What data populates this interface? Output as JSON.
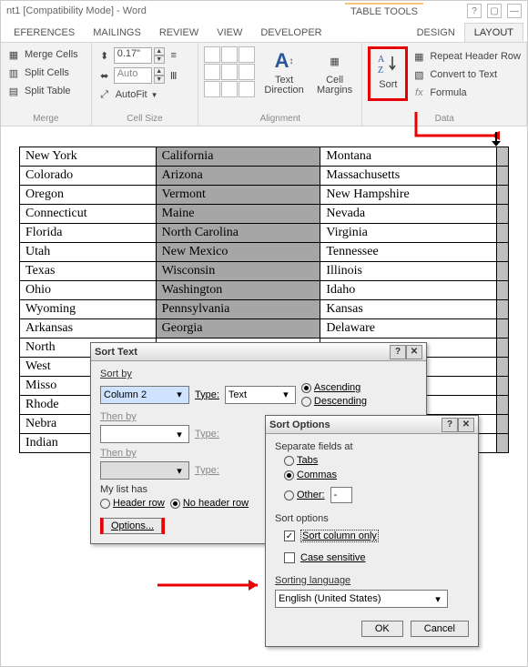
{
  "titlebar": {
    "doc": "nt1 [Compatibility Mode] - Word",
    "context": "TABLE TOOLS"
  },
  "tabs": {
    "references": "EFERENCES",
    "mailings": "MAILINGS",
    "review": "REVIEW",
    "view": "VIEW",
    "developer": "DEVELOPER",
    "design": "DESIGN",
    "layout": "LAYOUT"
  },
  "ribbon": {
    "merge": {
      "mergeCells": "Merge Cells",
      "splitCells": "Split Cells",
      "splitTable": "Split Table",
      "label": "Merge"
    },
    "cellsize": {
      "height": "0.17\"",
      "width": "Auto",
      "autofit": "AutoFit",
      "label": "Cell Size"
    },
    "alignment": {
      "textDirection": "Text Direction",
      "cellMargins": "Cell Margins",
      "label": "Alignment"
    },
    "data": {
      "sort": "Sort",
      "repeatHeader": "Repeat Header Row",
      "convertText": "Convert to Text",
      "formula": "Formula",
      "label": "Data"
    }
  },
  "table": {
    "rows": [
      [
        "New York",
        "California",
        "Montana"
      ],
      [
        "Colorado",
        "Arizona",
        "Massachusetts"
      ],
      [
        "Oregon",
        "Vermont",
        "New Hampshire"
      ],
      [
        "Connecticut",
        "Maine",
        "Nevada"
      ],
      [
        "Florida",
        "North Carolina",
        "Virginia"
      ],
      [
        "Utah",
        "New Mexico",
        "Tennessee"
      ],
      [
        "Texas",
        "Wisconsin",
        "Illinois"
      ],
      [
        "Ohio",
        "Washington",
        "Idaho"
      ],
      [
        "Wyoming",
        "Pennsylvania",
        "Kansas"
      ],
      [
        "Arkansas",
        "Georgia",
        "Delaware"
      ],
      [
        "North",
        "",
        ""
      ],
      [
        "West",
        "",
        ""
      ],
      [
        "Misso",
        "",
        ""
      ],
      [
        "Rhode",
        "",
        ""
      ],
      [
        "Nebra",
        "",
        ""
      ],
      [
        "Indian",
        "",
        ""
      ]
    ]
  },
  "sortText": {
    "title": "Sort Text",
    "sortBy": "Sort by",
    "thenBy": "Then by",
    "thenBy2": "Then by",
    "col": "Column 2",
    "typeLbl": "Type:",
    "typeVal": "Text",
    "asc": "Ascending",
    "desc": "Descending",
    "myListHas": "My list has",
    "headerRow": "Header row",
    "noHeaderRow": "No header row",
    "options": "Options..."
  },
  "sortOptions": {
    "title": "Sort Options",
    "separate": "Separate fields at",
    "tabs": "Tabs",
    "commas": "Commas",
    "other": "Other:",
    "otherVal": "-",
    "sortOptions": "Sort options",
    "colOnly": "Sort column only",
    "caseSens": "Case sensitive",
    "sortLang": "Sorting language",
    "lang": "English (United States)",
    "ok": "OK",
    "cancel": "Cancel"
  }
}
